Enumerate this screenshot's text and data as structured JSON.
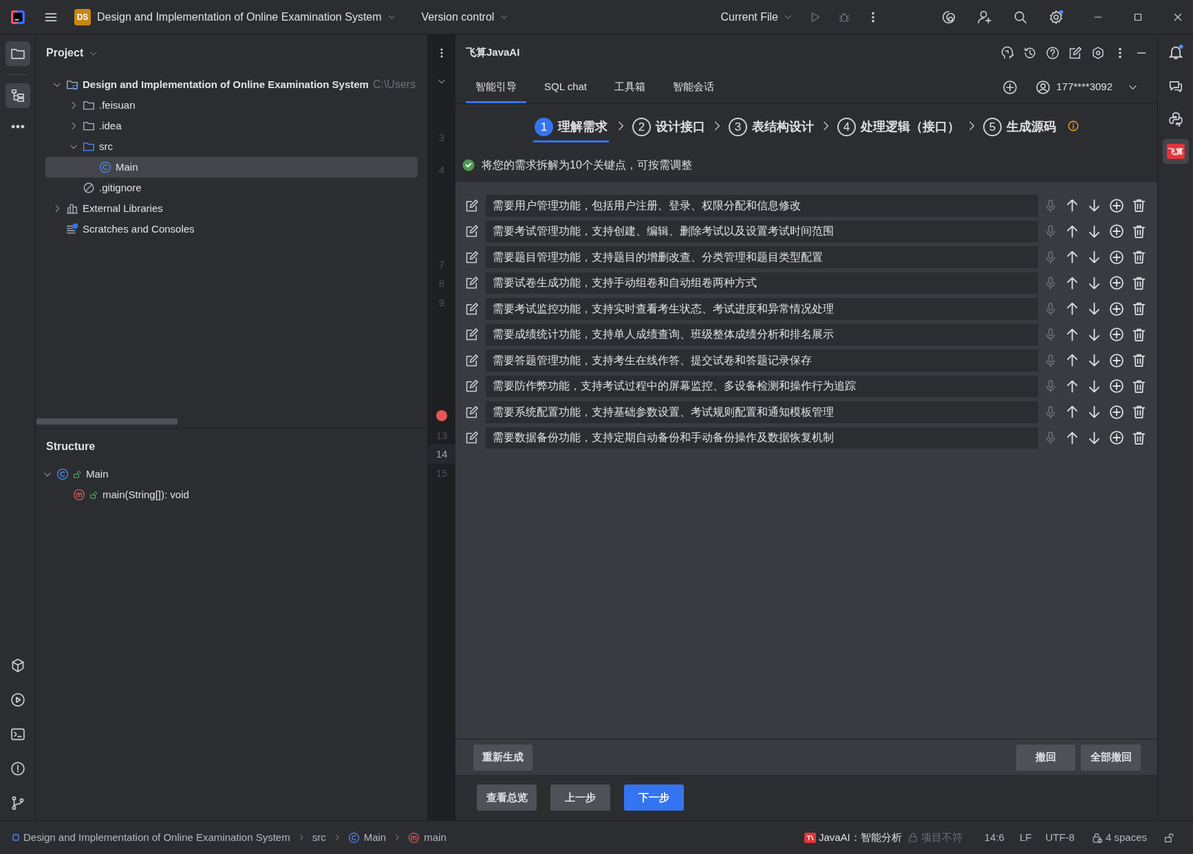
{
  "title_bar": {
    "project_badge": "DS",
    "project": "Design and Implementation of Online Examination System",
    "vcs": "Version control",
    "run_config": "Current File"
  },
  "project_panel": {
    "title": "Project",
    "tree": [
      {
        "label": "Design and Implementation of Online Examination System",
        "hint": "C:\\Users",
        "kind": "module",
        "expanded": true,
        "selected": false,
        "children": [
          {
            "label": ".feisuan",
            "kind": "folder",
            "expanded": false,
            "selected": false
          },
          {
            "label": ".idea",
            "kind": "folder",
            "expanded": false,
            "selected": false
          },
          {
            "label": "src",
            "kind": "folder",
            "expanded": true,
            "selected": false,
            "children": [
              {
                "label": "Main",
                "kind": "class",
                "selected": true
              }
            ]
          },
          {
            "label": ".gitignore",
            "kind": "ignore",
            "selected": false
          }
        ]
      },
      {
        "label": "External Libraries",
        "kind": "libraries",
        "expanded": false,
        "selected": false
      },
      {
        "label": "Scratches and Consoles",
        "kind": "scratches",
        "selected": false
      }
    ]
  },
  "structure_panel": {
    "title": "Structure",
    "tree": [
      {
        "label": "Main",
        "kind": "class",
        "expanded": true,
        "children": [
          {
            "label": "main(String[]): void",
            "kind": "method"
          }
        ]
      }
    ]
  },
  "gutter": {
    "lines": [
      {
        "kind": "number",
        "number": "3",
        "current": false
      },
      {
        "kind": "number",
        "number": "4",
        "current": false
      },
      {
        "kind": "number",
        "number": "7",
        "current": false
      },
      {
        "kind": "number",
        "number": "8",
        "current": false
      },
      {
        "kind": "number",
        "number": "9",
        "current": false
      },
      {
        "kind": "breakpoint",
        "current": false
      },
      {
        "kind": "number",
        "number": "13",
        "current": false
      },
      {
        "kind": "number",
        "number": "14",
        "current": true
      },
      {
        "kind": "number",
        "number": "15",
        "current": false
      }
    ]
  },
  "ai_panel": {
    "title": "飞算JavaAI",
    "tabs": [
      {
        "label": "智能引导",
        "selected": true
      },
      {
        "label": "SQL chat",
        "selected": false
      },
      {
        "label": "工具箱",
        "selected": false
      },
      {
        "label": "智能会话",
        "selected": false
      }
    ],
    "account": "177****3092",
    "steps": [
      {
        "number": "1",
        "label": "理解需求",
        "selected": true
      },
      {
        "number": "2",
        "label": "设计接口",
        "selected": false
      },
      {
        "number": "3",
        "label": "表结构设计",
        "selected": false
      },
      {
        "number": "4",
        "label": "处理逻辑（接口）",
        "selected": false
      },
      {
        "number": "5",
        "label": "生成源码",
        "selected": false
      }
    ],
    "notice": "将您的需求拆解为10个关键点，可按需调整",
    "requirements": [
      "需要用户管理功能，包括用户注册、登录、权限分配和信息修改",
      "需要考试管理功能，支持创建、编辑、删除考试以及设置考试时间范围",
      "需要题目管理功能，支持题目的增删改查、分类管理和题目类型配置",
      "需要试卷生成功能，支持手动组卷和自动组卷两种方式",
      "需要考试监控功能，支持实时查看考生状态、考试进度和异常情况处理",
      "需要成绩统计功能，支持单人成绩查询、班级整体成绩分析和排名展示",
      "需要答题管理功能，支持考生在线作答、提交试卷和答题记录保存",
      "需要防作弊功能，支持考试过程中的屏幕监控、多设备检测和操作行为追踪",
      "需要系统配置功能，支持基础参数设置、考试规则配置和通知模板管理",
      "需要数据备份功能，支持定期自动备份和手动备份操作及数据恢复机制"
    ],
    "toolbar": {
      "regenerate": "重新生成",
      "undo": "撤回",
      "undo_all": "全部撤回"
    },
    "footer_buttons": [
      {
        "label": "查看总览",
        "primary": false
      },
      {
        "label": "上一步",
        "primary": false
      },
      {
        "label": "下一步",
        "primary": true
      }
    ]
  },
  "right_strip": {
    "plugin_logo": "飞算"
  },
  "status_bar": {
    "breadcrumbs": [
      {
        "label": "Design and Implementation of Online Examination System",
        "kind": "module"
      },
      {
        "label": "src",
        "kind": "folder"
      },
      {
        "label": "Main",
        "kind": "class"
      },
      {
        "label": "main",
        "kind": "method"
      }
    ],
    "plugin_label": "JavaAI：智能分析",
    "plugin_note": "项目不符",
    "position": "14:6",
    "line_ending": "LF",
    "encoding": "UTF-8",
    "indent": "4 spaces"
  }
}
